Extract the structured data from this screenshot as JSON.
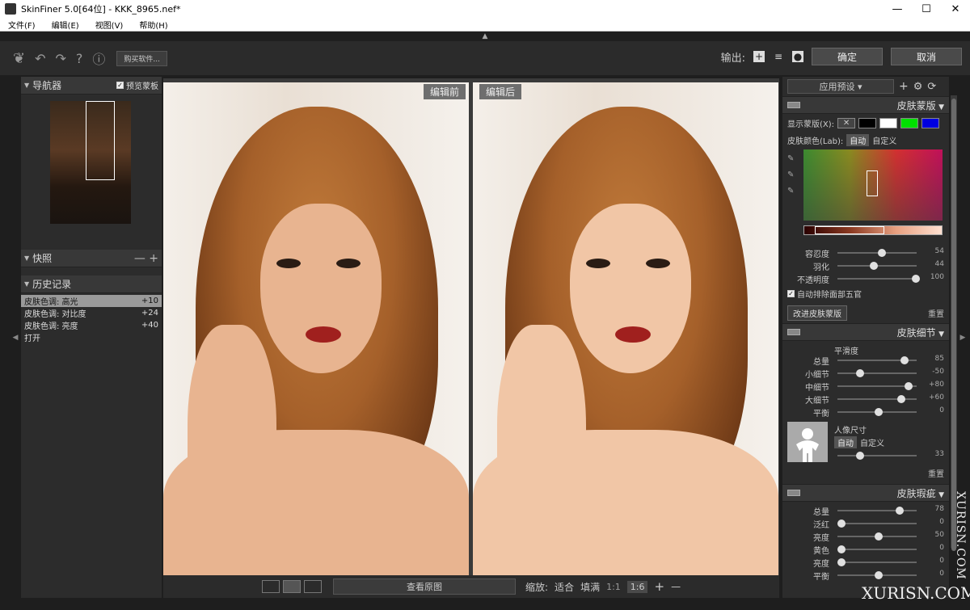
{
  "window": {
    "title": "SkinFiner 5.0[64位] - KKK_8965.nef*",
    "min": "—",
    "max": "☐",
    "close": "✕"
  },
  "menu": [
    "文件(F)",
    "编辑(E)",
    "视图(V)",
    "帮助(H)"
  ],
  "toolbar": {
    "buy_label": "购买软件...",
    "output_label": "输出:",
    "ok_label": "确定",
    "cancel_label": "取消",
    "help": "?",
    "info": "ⓘ"
  },
  "left": {
    "navigator": {
      "title": "导航器",
      "preview_mask": "预览蒙板"
    },
    "snapshot": {
      "title": "快照",
      "minus": "—",
      "plus": "+"
    },
    "history": {
      "title": "历史记录",
      "items": [
        {
          "label": "皮肤色调: 高光",
          "value": "+10"
        },
        {
          "label": "皮肤色调: 对比度",
          "value": "+24"
        },
        {
          "label": "皮肤色调: 亮度",
          "value": "+40"
        },
        {
          "label": "打开",
          "value": ""
        }
      ]
    }
  },
  "viewer": {
    "before_label": "编辑前",
    "after_label": "编辑后"
  },
  "bottom": {
    "view_original": "查看原图",
    "zoom_label": "缩放:",
    "fit": "适合",
    "fill": "填满",
    "one_one": "1:1",
    "ratio": "1:6",
    "plus": "+",
    "minus": "—"
  },
  "right": {
    "preset": "应用预设",
    "skin_mask": {
      "title": "皮肤蒙版",
      "show_mask": "显示蒙版(X):",
      "swatch_colors": [
        "#000000",
        "#ffffff",
        "#00e000",
        "#0000e0"
      ],
      "skin_color_label": "皮肤颜色(Lab):",
      "auto": "自动",
      "custom": "自定义",
      "sliders": [
        {
          "name": "容忍度",
          "value": "54",
          "pos": 0.54
        },
        {
          "name": "羽化",
          "value": "44",
          "pos": 0.44
        },
        {
          "name": "不透明度",
          "value": "100",
          "pos": 1.0
        }
      ],
      "auto_exclude": "自动排除面部五官",
      "improve_btn": "改进皮肤蒙版",
      "reset": "重置"
    },
    "skin_detail": {
      "title": "皮肤细节",
      "smoothness": "平滑度",
      "sliders": [
        {
          "name": "总量",
          "value": "85",
          "pos": 0.85
        },
        {
          "name": "小细节",
          "value": "-50",
          "pos": 0.25
        },
        {
          "name": "中细节",
          "value": "+80",
          "pos": 0.9
        },
        {
          "name": "大细节",
          "value": "+60",
          "pos": 0.8
        },
        {
          "name": "平衡",
          "value": "0",
          "pos": 0.5
        }
      ],
      "portrait_size": "人像尺寸",
      "auto": "自动",
      "custom": "自定义",
      "size_value": "33",
      "size_pos": 0.25,
      "reset": "重置"
    },
    "skin_blemish": {
      "title": "皮肤瑕疵",
      "sliders": [
        {
          "name": "总量",
          "value": "78",
          "pos": 0.78
        },
        {
          "name": "泛红",
          "value": "0",
          "pos": 0.0
        },
        {
          "name": "亮度",
          "value": "50",
          "pos": 0.5
        },
        {
          "name": "黄色",
          "value": "0",
          "pos": 0.0
        },
        {
          "name": "亮度",
          "value": "0",
          "pos": 0.0
        },
        {
          "name": "平衡",
          "value": "0",
          "pos": 0.5
        }
      ]
    }
  },
  "watermark": {
    "vertical": "XURISN.COM",
    "horizontal": "XURISN.COM"
  }
}
